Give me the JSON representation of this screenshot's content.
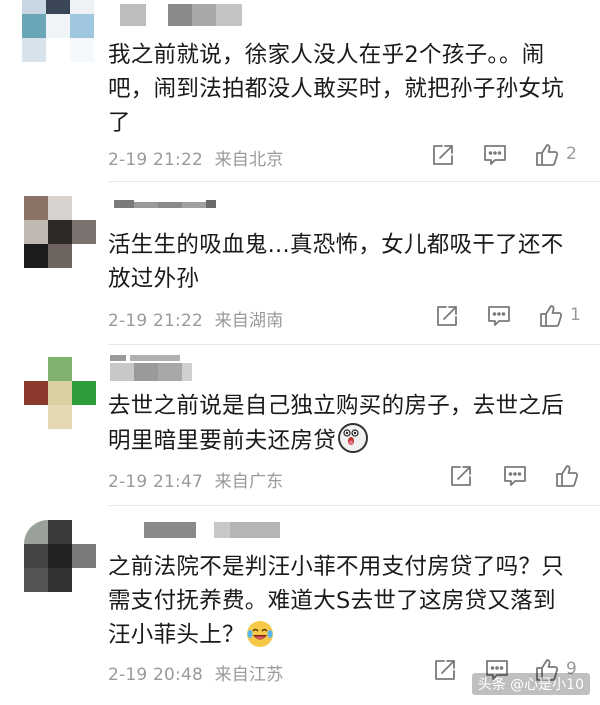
{
  "comments": [
    {
      "text": "我之前就说，徐家人没人在乎2个孩子。。闹吧，闹到法拍都没人敢买时，就把孙子孙女坑了",
      "time": "2-19 21:22",
      "location": "来自北京",
      "likes": "2",
      "emoji": ""
    },
    {
      "text": "活生生的吸血鬼...真恐怖，女儿都吸干了还不放过外孙",
      "time": "2-19 21:22",
      "location": "来自湖南",
      "likes": "1",
      "emoji": ""
    },
    {
      "text": "去世之前说是自己独立购买的房子，去世之后明里暗里要前夫还房贷",
      "time": "2-19 21:47",
      "location": "来自广东",
      "likes": "",
      "emoji": "scared-face"
    },
    {
      "text": "之前法院不是判汪小菲不用支付房贷了吗？只需支付抚养费。难道大S去世了这房贷又落到汪小菲头上？",
      "time": "2-19 20:48",
      "location": "来自江苏",
      "likes": "9",
      "emoji": "laughing-tears"
    }
  ],
  "watermark": "头条 @心是小10",
  "icons": {
    "forward": "share-icon",
    "comment": "comment-icon",
    "like": "thumb-up-icon"
  },
  "colors": {
    "text": "#1a1a1a",
    "meta": "#9a9a9a",
    "icon": "#7a7a7a"
  }
}
